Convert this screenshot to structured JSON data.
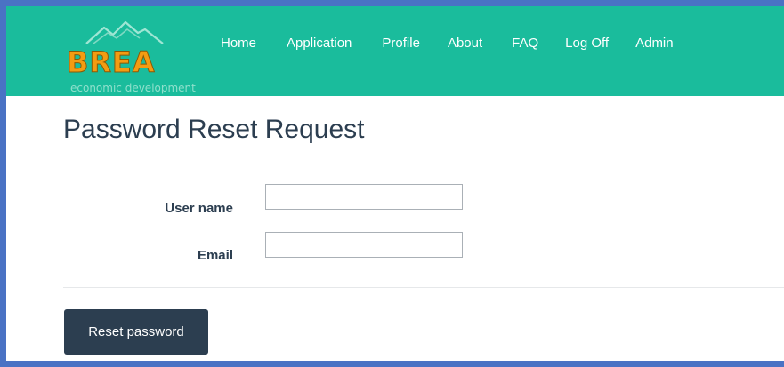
{
  "brand": {
    "logo_text": "BREA",
    "logo_subtext": "economic development"
  },
  "nav": {
    "items": [
      {
        "label": "Home"
      },
      {
        "label": "Application"
      },
      {
        "label": "Profile"
      },
      {
        "label": "About"
      },
      {
        "label": "FAQ"
      },
      {
        "label": "Log Off"
      },
      {
        "label": "Admin"
      }
    ]
  },
  "page": {
    "title": "Password Reset Request"
  },
  "form": {
    "username_label": "User name",
    "username_value": "",
    "email_label": "Email",
    "email_value": "",
    "submit_label": "Reset password"
  },
  "colors": {
    "navbar": "#1abc9c",
    "logo": "#f39c12",
    "button": "#2c3e50",
    "text": "#2c3e50",
    "frame": "#4a72c4"
  }
}
